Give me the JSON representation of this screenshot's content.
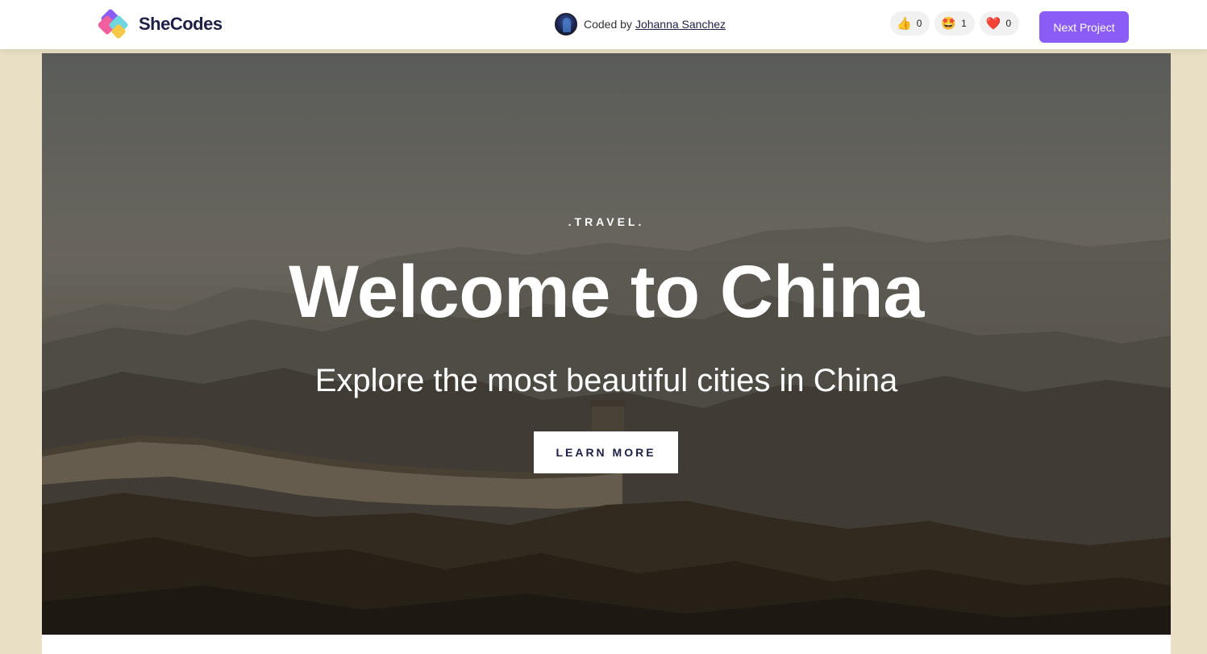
{
  "topbar": {
    "logo_text": "SheCodes",
    "coded_by_label": "Coded by",
    "author_name": "Johanna Sanchez",
    "reactions": [
      {
        "icon": "thumbs-up-icon",
        "glyph": "👍",
        "count": "0"
      },
      {
        "icon": "star-struck-icon",
        "glyph": "🤩",
        "count": "1"
      },
      {
        "icon": "heart-icon",
        "glyph": "❤️",
        "count": "0"
      }
    ],
    "next_button_label": "Next Project"
  },
  "hero": {
    "eyebrow": ".TRAVEL.",
    "title": "Welcome to China",
    "subtitle": "Explore the most beautiful cities in China",
    "cta_label": "LEARN MORE"
  },
  "colors": {
    "page_background": "#e8dfc4",
    "accent_purple": "#8b5cf6",
    "logo_navy": "#1d1f44"
  }
}
